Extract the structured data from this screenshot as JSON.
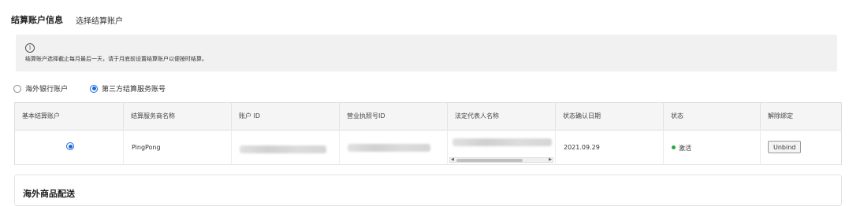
{
  "header": {
    "title": "结算账户信息",
    "subtitle": "选择结算账户"
  },
  "notice": {
    "icon": "info-icon",
    "text": "结算账户选择截止每月最后一天，请于月底前设置结算账户以便按时结算。"
  },
  "account_type": {
    "options": [
      {
        "label": "海外银行账户",
        "selected": false
      },
      {
        "label": "第三方结算服务账号",
        "selected": true
      }
    ]
  },
  "table": {
    "columns": [
      "基本结算账户",
      "结算服务商名称",
      "账户 ID",
      "营业执照号ID",
      "法定代表人名称",
      "状态确认日期",
      "状态",
      "解除绑定"
    ],
    "rows": [
      {
        "primary_selected": true,
        "provider": "PingPong",
        "account_id": "",
        "license_id": "",
        "legal_rep": "",
        "confirm_date": "2021.09.29",
        "status": "激活",
        "action": "Unbind"
      }
    ]
  },
  "section2": {
    "title": "海外商品配送"
  },
  "colors": {
    "accent": "#1769e0",
    "status_active": "#27a745",
    "notice_bg": "#f1f1f1",
    "header_bg": "#f5f5f5"
  }
}
